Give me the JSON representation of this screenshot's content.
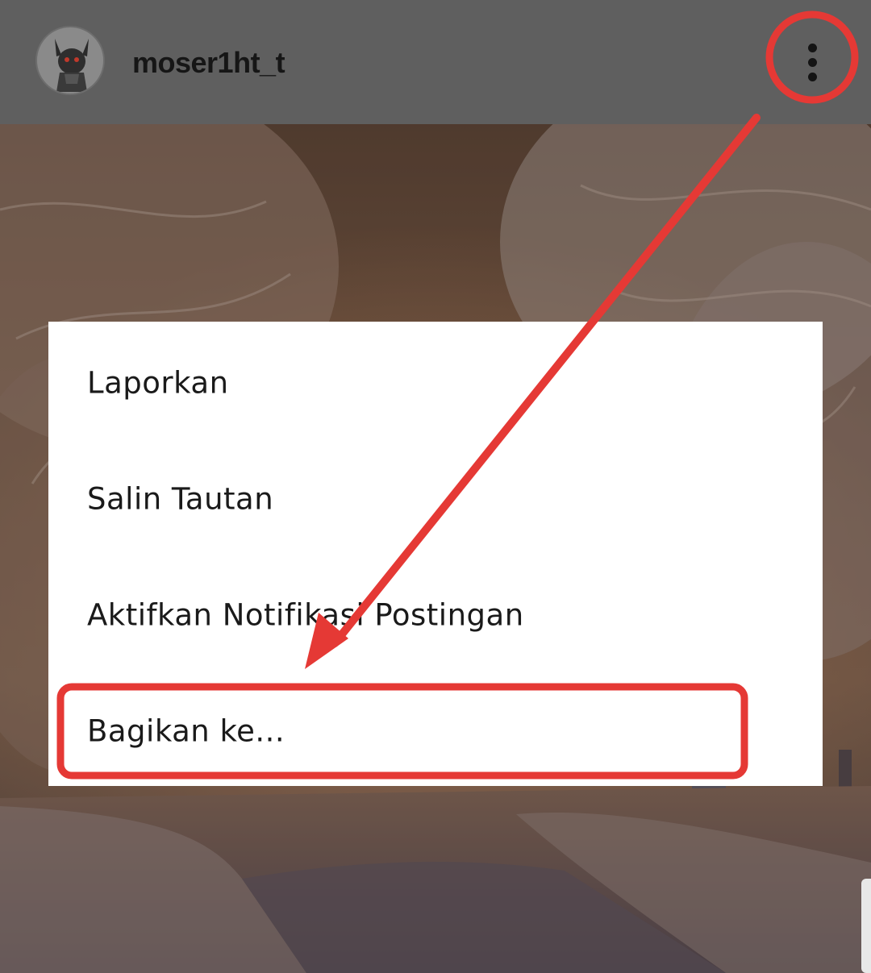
{
  "header": {
    "username": "moser1ht_t",
    "avatar_icon": "demon-character-avatar",
    "more_icon": "vertical-ellipsis-icon"
  },
  "menu": {
    "items": [
      {
        "label": "Laporkan"
      },
      {
        "label": "Salin Tautan"
      },
      {
        "label": "Aktifkan Notifikasi Postingan"
      },
      {
        "label": "Bagikan ke..."
      }
    ]
  },
  "annotation": {
    "color": "#e53935",
    "highlight_targets": [
      "more-options-button",
      "menu-item-share-to"
    ]
  },
  "colors": {
    "header_bg": "#5f5f5f",
    "menu_bg": "#ffffff",
    "text": "#1a1a1a",
    "annotation_red": "#e53935"
  }
}
